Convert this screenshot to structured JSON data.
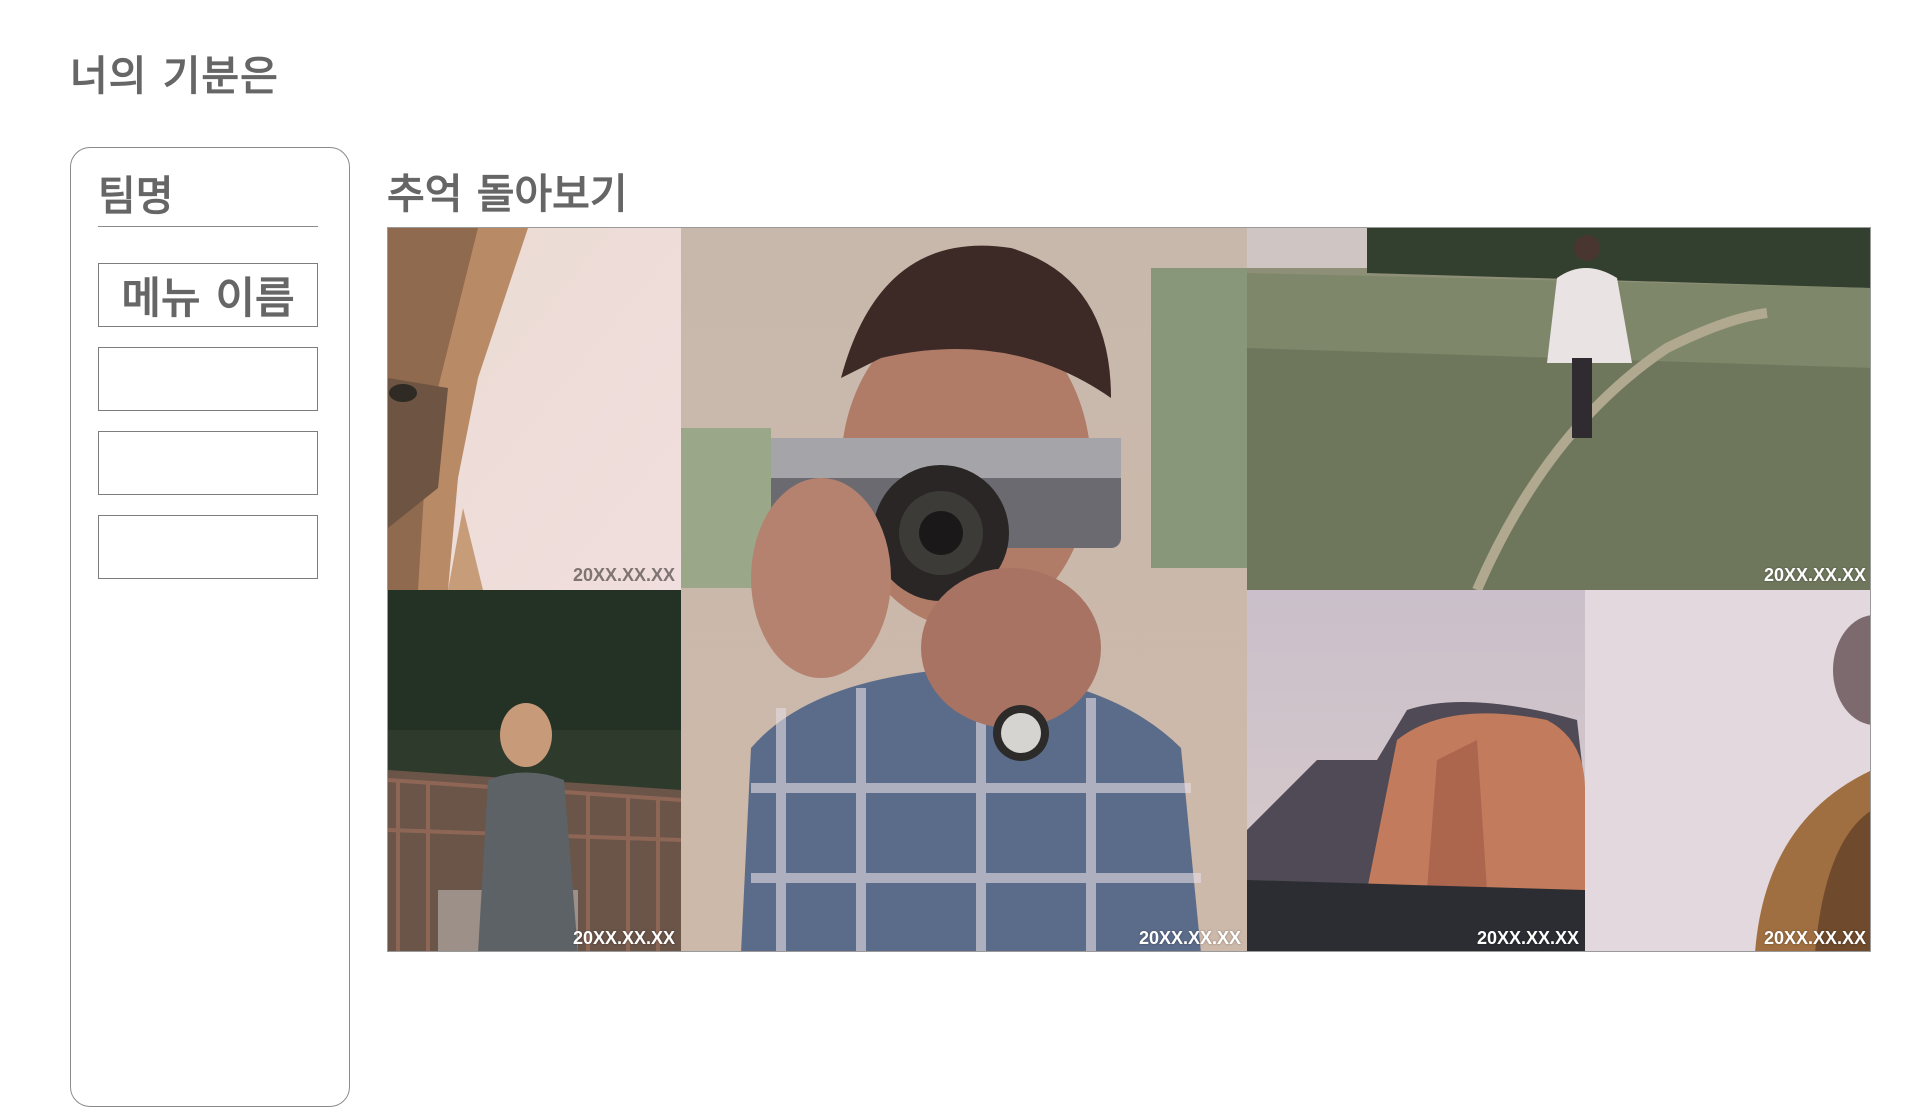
{
  "app": {
    "title": "너의 기분은"
  },
  "sidebar": {
    "team_name": "팀명",
    "menu_items": [
      {
        "label": "메뉴 이름"
      },
      {
        "label": ""
      },
      {
        "label": ""
      },
      {
        "label": ""
      }
    ]
  },
  "main": {
    "section_title": "추억 돌아보기",
    "photos": [
      {
        "subject": "fox-closeup",
        "date": "20XX.XX.XX"
      },
      {
        "subject": "woman-on-bridge",
        "date": "20XX.XX.XX"
      },
      {
        "subject": "man-with-camera",
        "date": "20XX.XX.XX"
      },
      {
        "subject": "woman-in-wheat-field",
        "date": "20XX.XX.XX"
      },
      {
        "subject": "half-dome-mountain",
        "date": "20XX.XX.XX"
      },
      {
        "subject": "person-in-hat",
        "date": "20XX.XX.XX"
      }
    ]
  },
  "colors": {
    "text": "#666666",
    "border": "#8a8a8a",
    "date_label": "#ffffff"
  }
}
